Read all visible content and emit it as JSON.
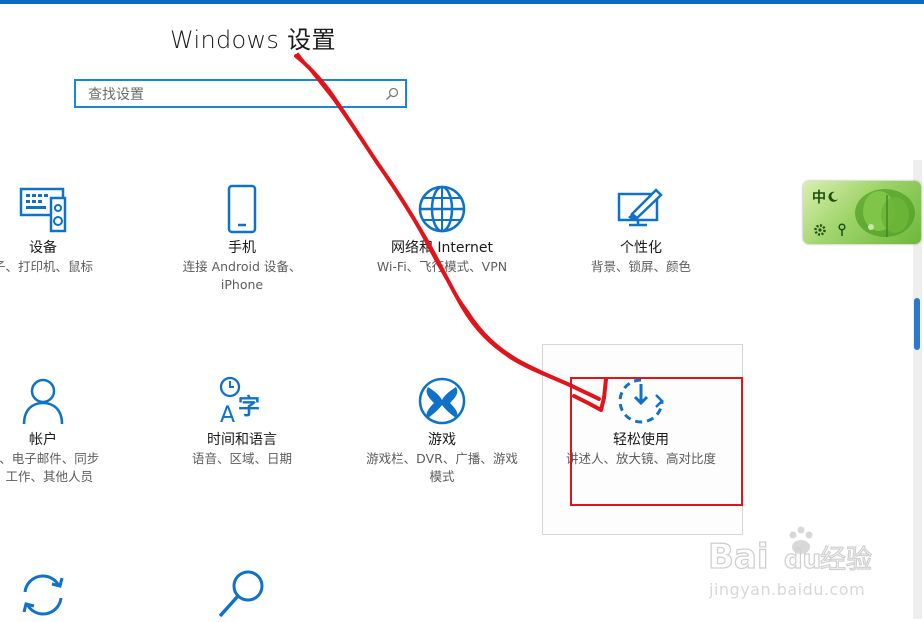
{
  "page": {
    "title": "Windows 设置"
  },
  "search": {
    "placeholder": "查找设置"
  },
  "tiles": [
    {
      "name": "设备",
      "desc1": "子、打印机、鼠标",
      "desc2": "",
      "icon": "devices-icon"
    },
    {
      "name": "手机",
      "desc1": "连接 Android 设备、",
      "desc2": "iPhone",
      "icon": "phone-icon"
    },
    {
      "name": "网络和 Internet",
      "desc1": "Wi-Fi、飞行模式、VPN",
      "desc2": "",
      "icon": "globe-icon"
    },
    {
      "name": "个性化",
      "desc1": "背景、锁屏、颜色",
      "desc2": "",
      "icon": "personalization-icon"
    },
    {
      "name": "帐户",
      "desc1": "户、电子邮件、同步",
      "desc2": "、工作、其他人员",
      "icon": "account-icon"
    },
    {
      "name": "时间和语言",
      "desc1": "语音、区域、日期",
      "desc2": "",
      "icon": "time-language-icon"
    },
    {
      "name": "游戏",
      "desc1": "游戏栏、DVR、广播、游戏",
      "desc2": "模式",
      "icon": "xbox-icon"
    },
    {
      "name": "轻松使用",
      "desc1": "讲述人、放大镜、高对比度",
      "desc2": "",
      "icon": "ease-of-access-icon"
    }
  ],
  "ime": {
    "lang": "中",
    "icon": "ime-leaf-icon"
  },
  "watermark": {
    "brand_left": "Bai",
    "brand_right": "du",
    "brand_cn": "经验",
    "url": "jingyan.baidu.com"
  },
  "colors": {
    "accent": "#0b6bc4",
    "icon_blue": "#0f72c8",
    "annotation_red": "#e0141b"
  }
}
